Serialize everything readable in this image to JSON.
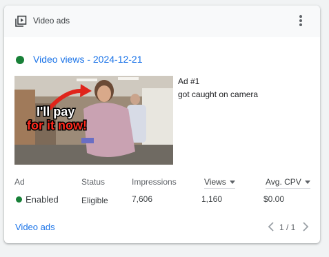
{
  "header": {
    "title": "Video ads",
    "icon": "video-library-icon"
  },
  "campaign": {
    "status_color": "#188038",
    "link_text": "Video views - 2024-12-21"
  },
  "ad": {
    "number": "Ad #1",
    "title": "got caught on camera",
    "thumbnail_caption_line1": "I'll pay",
    "thumbnail_caption_line2": "for it now!"
  },
  "table": {
    "columns": {
      "ad": "Ad",
      "status": "Status",
      "impressions": "Impressions",
      "views": "Views",
      "avg_cpv": "Avg. CPV"
    },
    "row": {
      "ad": "Enabled",
      "status": "Eligible",
      "impressions": "7,606",
      "views": "1,160",
      "avg_cpv": "$0.00"
    }
  },
  "footer": {
    "link": "Video ads",
    "pager": "1 / 1"
  },
  "colors": {
    "accent": "#1a73e8",
    "enabled": "#188038"
  }
}
